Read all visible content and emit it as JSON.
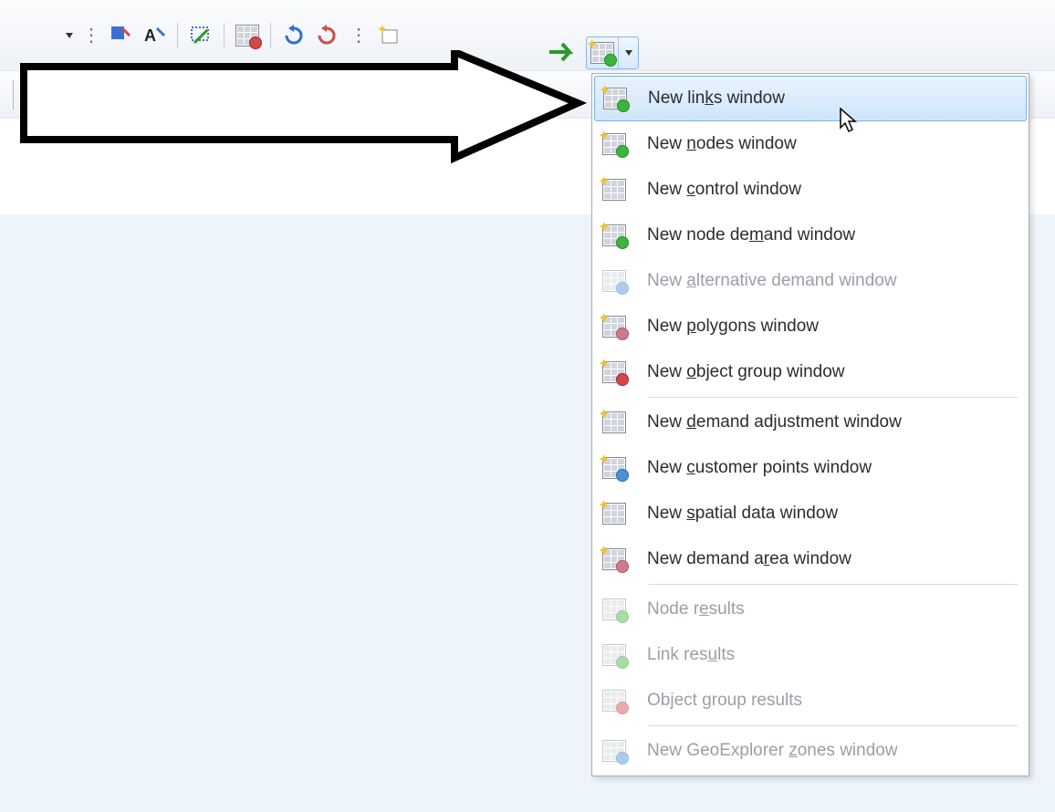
{
  "toolbar": {
    "buttons": [
      {
        "name": "font-blue-icon",
        "interactable": true
      },
      {
        "name": "font-annotate-icon",
        "interactable": true
      },
      {
        "sep": true
      },
      {
        "name": "select-elements-icon",
        "interactable": true
      },
      {
        "sep": true
      },
      {
        "name": "grid-check-icon",
        "interactable": true
      },
      {
        "sep": true
      },
      {
        "name": "refresh-icon",
        "interactable": true
      },
      {
        "name": "refresh-error-icon",
        "interactable": true
      },
      {
        "dots": true
      },
      {
        "name": "new-star-icon",
        "interactable": true
      }
    ],
    "split_button": {
      "icon": "new-grid-window-icon"
    }
  },
  "menu": {
    "items": [
      {
        "label_pre": "New lin",
        "underline": "k",
        "label_post": "s window",
        "icon": "links-icon",
        "disabled": false,
        "highlighted": true,
        "name": "menu-new-links-window"
      },
      {
        "label_pre": "New ",
        "underline": "n",
        "label_post": "odes window",
        "icon": "nodes-icon",
        "disabled": false,
        "name": "menu-new-nodes-window"
      },
      {
        "label_pre": "New ",
        "underline": "c",
        "label_post": "ontrol window",
        "icon": "control-icon",
        "disabled": false,
        "name": "menu-new-control-window"
      },
      {
        "label_pre": "New node de",
        "underline": "m",
        "label_post": "and window",
        "icon": "demand-icon",
        "disabled": false,
        "name": "menu-new-node-demand-window"
      },
      {
        "label_pre": "New ",
        "underline": "a",
        "label_post": "lternative demand window",
        "icon": "alt-demand-icon",
        "disabled": true,
        "name": "menu-new-alternative-demand-window"
      },
      {
        "label_pre": "New ",
        "underline": "p",
        "label_post": "olygons window",
        "icon": "polygons-icon",
        "disabled": false,
        "name": "menu-new-polygons-window"
      },
      {
        "label_pre": "New ",
        "underline": "o",
        "label_post": "bject group window",
        "icon": "object-group-icon",
        "disabled": false,
        "name": "menu-new-object-group-window"
      },
      {
        "sep": true
      },
      {
        "label_pre": "New ",
        "underline": "d",
        "label_post": "emand adjustment window",
        "icon": "demand-adj-icon",
        "disabled": false,
        "name": "menu-new-demand-adjustment-window"
      },
      {
        "label_pre": "New ",
        "underline": "c",
        "label_post": "ustomer points window",
        "icon": "customer-points-icon",
        "disabled": false,
        "name": "menu-new-customer-points-window"
      },
      {
        "label_pre": "New ",
        "underline": "s",
        "label_post": "patial data window",
        "icon": "spatial-data-icon",
        "disabled": false,
        "name": "menu-new-spatial-data-window"
      },
      {
        "label_pre": "New demand a",
        "underline": "r",
        "label_post": "ea window",
        "icon": "demand-area-icon",
        "disabled": false,
        "name": "menu-new-demand-area-window"
      },
      {
        "sep": true
      },
      {
        "label_pre": "Node r",
        "underline": "e",
        "label_post": "sults",
        "icon": "node-results-icon",
        "disabled": true,
        "name": "menu-node-results"
      },
      {
        "label_pre": "Link res",
        "underline": "u",
        "label_post": "lts",
        "icon": "link-results-icon",
        "disabled": true,
        "name": "menu-link-results"
      },
      {
        "label_pre": "Object ",
        "underline": "g",
        "label_post": "roup results",
        "icon": "object-group-results-icon",
        "disabled": true,
        "name": "menu-object-group-results"
      },
      {
        "sep": true
      },
      {
        "label_pre": "New GeoExplorer ",
        "underline": "z",
        "label_post": "ones window",
        "icon": "geoexplorer-icon",
        "disabled": true,
        "name": "menu-new-geoexplorer-zones-window"
      }
    ]
  }
}
